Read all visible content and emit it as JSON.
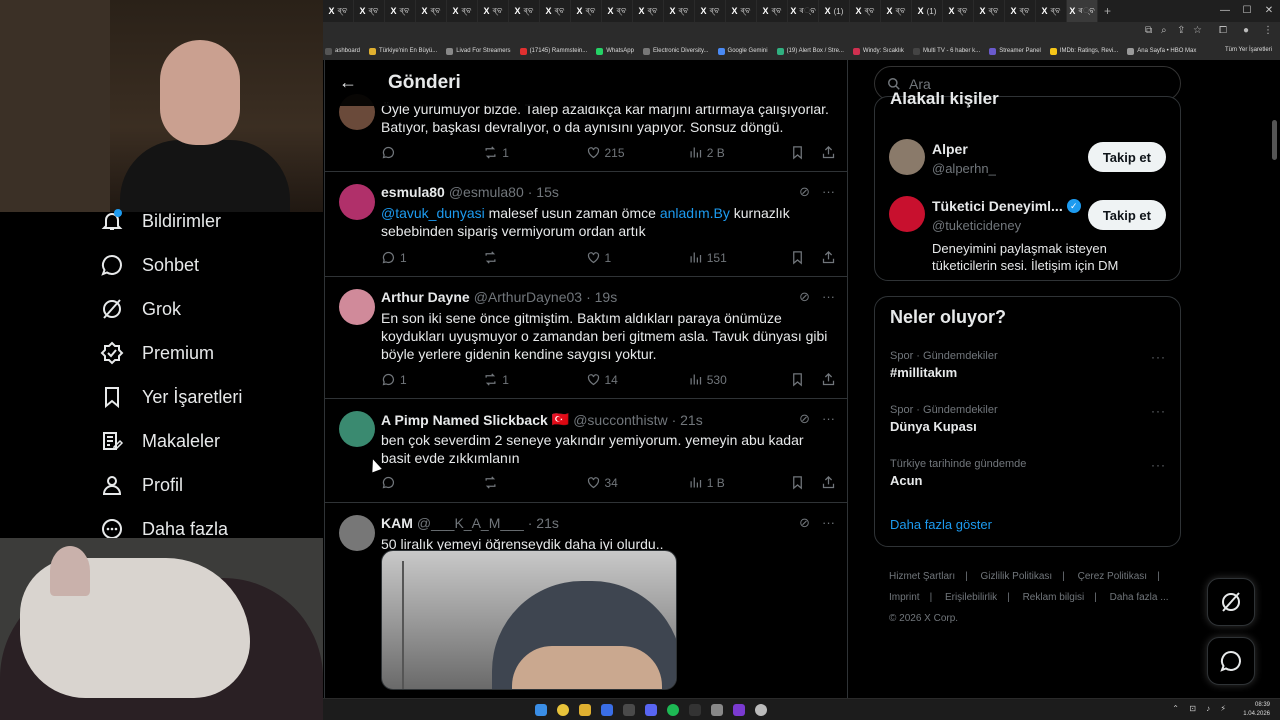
{
  "browser": {
    "tabs": [
      {
        "label": "X",
        "sub": "ৰ্‌ବ"
      },
      {
        "label": "X",
        "sub": "ৰ্‌ବ"
      },
      {
        "label": "X",
        "sub": "ৰ্‌ବ"
      },
      {
        "label": "X",
        "sub": "ৰ্‌ବ"
      },
      {
        "label": "X",
        "sub": "ৰ্‌ବ"
      },
      {
        "label": "X",
        "sub": "ৰ্‌ବ"
      },
      {
        "label": "X",
        "sub": "ৰ্‌ବ"
      },
      {
        "label": "X",
        "sub": "ৰ্‌ବ"
      },
      {
        "label": "X",
        "sub": "ৰ্‌ବ"
      },
      {
        "label": "X",
        "sub": "ৰ্‌ବ"
      },
      {
        "label": "X",
        "sub": "ৰ্‌ବ"
      },
      {
        "label": "X",
        "sub": "ৰ্‌ବ"
      },
      {
        "label": "X",
        "sub": "ৰ্‌ବ"
      },
      {
        "label": "X",
        "sub": "ৰ্‌ବ"
      },
      {
        "label": "X",
        "sub": "ৰ্‌ବ"
      },
      {
        "label": "X",
        "sub": "ৰ୍‌ବ"
      },
      {
        "label": "X",
        "sub": "(1)"
      },
      {
        "label": "X",
        "sub": "ৰ্‌ବ"
      },
      {
        "label": "X",
        "sub": "ৰ্‌ବ"
      },
      {
        "label": "X",
        "sub": "(1)"
      },
      {
        "label": "X",
        "sub": "ৰ্‌ବ"
      },
      {
        "label": "X",
        "sub": "ৰ্‌ବ"
      },
      {
        "label": "X",
        "sub": "ৰ্‌ବ"
      },
      {
        "label": "X",
        "sub": "ৰ্‌ବ"
      },
      {
        "label": "X",
        "sub": "ৰ୍‌ବ"
      }
    ],
    "bookmarks": [
      {
        "label": "ashboard",
        "color": "#555555"
      },
      {
        "label": "Türkiye'nin En Büyü...",
        "color": "#e0b030"
      },
      {
        "label": "Livad For Streamers",
        "color": "#888888"
      },
      {
        "label": "(17145) Rammstein...",
        "color": "#e03030"
      },
      {
        "label": "WhatsApp",
        "color": "#25d366"
      },
      {
        "label": "Electronic Diversity...",
        "color": "#777777"
      },
      {
        "label": "Google Gemini",
        "color": "#4a8af4"
      },
      {
        "label": "(19) Alert Box / Stre...",
        "color": "#30b080"
      },
      {
        "label": "Windy: Sıcaklık",
        "color": "#d03050"
      },
      {
        "label": "Multi TV - 6 haber k...",
        "color": "#444444"
      },
      {
        "label": "Streamer Panel",
        "color": "#6a5acd"
      },
      {
        "label": "IMDb: Ratings, Revi...",
        "color": "#f5c518"
      },
      {
        "label": "Ana Sayfa • HBO Max",
        "color": "#9a9a9a"
      }
    ],
    "bookmarks_all": "Tüm Yer İşaretleri"
  },
  "sidebar": {
    "items": [
      {
        "label": "Bildirimler",
        "icon": "bell-icon"
      },
      {
        "label": "Sohbet",
        "icon": "chat-icon"
      },
      {
        "label": "Grok",
        "icon": "grok-icon"
      },
      {
        "label": "Premium",
        "icon": "premium-icon"
      },
      {
        "label": "Yer İşaretleri",
        "icon": "bookmark-icon"
      },
      {
        "label": "Makaleler",
        "icon": "article-icon"
      },
      {
        "label": "Profil",
        "icon": "profile-icon"
      },
      {
        "label": "Daha fazla",
        "icon": "more-icon"
      }
    ]
  },
  "main": {
    "title": "Gönderi",
    "posts": [
      {
        "name": "",
        "handle": "",
        "time": "",
        "text": "Öyle yürümüyor bizde. Talep azaldıkça kâr marjını artırmaya çalışıyorlar. Batıyor, başkası devralıyor, o da aynısını yapıyor. Sonsuz döngü.",
        "replies": "",
        "reposts": "1",
        "likes": "215",
        "views": "2 B",
        "avatar_color": "#6a4a3a"
      },
      {
        "name": "esmula80",
        "handle": "@esmula80",
        "time": "· 15s",
        "text_parts": [
          {
            "t": "@tavuk_dunyasi",
            "link": true
          },
          {
            "t": " malesef usun zaman ömce ",
            "link": false
          },
          {
            "t": "anladım.By",
            "link": true
          },
          {
            "t": " kurnazlık sebebinden sipariş vermiyorum ordan artık",
            "link": false
          }
        ],
        "replies": "1",
        "reposts": "",
        "likes": "1",
        "views": "151",
        "avatar_color": "#b0306a"
      },
      {
        "name": "Arthur Dayne",
        "handle": "@ArthurDayne03",
        "time": "· 19s",
        "text": "En son iki sene önce gitmiştim. Baktım aldıkları paraya önümüze koydukları uyuşmuyor o zamandan beri gitmem asla. Tavuk dünyası gibi böyle yerlere gidenin kendine saygısı yoktur.",
        "replies": "1",
        "reposts": "1",
        "likes": "14",
        "views": "530",
        "avatar_color": "#d08a9a"
      },
      {
        "name": "A Pimp Named Slickback",
        "flag": "🇹🇷",
        "handle": "@succonthistw",
        "time": "· 21s",
        "text": "ben çok severdim 2 seneye yakındır yemiyorum. yemeyin abu kadar basit evde zıkkımlanın",
        "replies": "",
        "reposts": "",
        "likes": "34",
        "views": "1 B",
        "avatar_color": "#3a8a70"
      },
      {
        "name": "KAM",
        "handle": "@___K_A_M___",
        "time": "· 21s",
        "text": "50 liralık yemeyi öğrenseydik daha iyi olurdu..",
        "avatar_color": "#777777"
      }
    ]
  },
  "right": {
    "search_placeholder": "Ara",
    "relevant_title": "Alakalı kişiler",
    "people": [
      {
        "name": "Alper",
        "handle": "@alperhn_",
        "bio": "",
        "button": "Takip et",
        "avatar_color": "#8a7a6a",
        "verified": false
      },
      {
        "name": "Tüketici Deneyiml...",
        "handle": "@tuketicideney",
        "bio": "Deneyimini paylaşmak isteyen tüketicilerin sesi. İletişim için DM",
        "button": "Takip et",
        "avatar_color": "#c8102e",
        "verified": true
      }
    ],
    "trends_title": "Neler oluyor?",
    "trends": [
      {
        "context": "Spor · Gündemdekiler",
        "name": "#millitakım"
      },
      {
        "context": "Spor · Gündemdekiler",
        "name": "Dünya Kupası"
      },
      {
        "context": "Türkiye tarihinde gündemde",
        "name": "Acun"
      }
    ],
    "show_more": "Daha fazla göster",
    "footer": {
      "links": [
        "Hizmet Şartları",
        "|",
        "Gizlilik Politikası",
        "|",
        "Çerez Politikası",
        "|",
        "Imprint",
        "|",
        "Erişilebilirlik",
        "|",
        "Reklam bilgisi",
        "|",
        "Daha fazla ..."
      ],
      "copyright": "© 2026 X Corp."
    }
  },
  "taskbar": {
    "time": "08:39",
    "date": "1.04.2026"
  },
  "colors": {
    "accent": "#1d9bf0",
    "border": "#2f3336",
    "muted": "#71767b"
  }
}
